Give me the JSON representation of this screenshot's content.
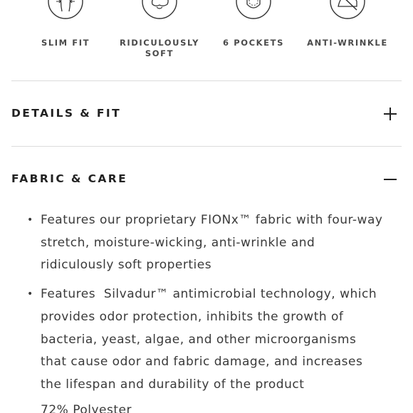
{
  "features": [
    {
      "label": "SLIM FIT",
      "icon": "slim-fit-icon"
    },
    {
      "label": "RIDICULOUSLY\nSOFT",
      "icon": "cotton-soft-icon"
    },
    {
      "label": "6 POCKETS",
      "icon": "pocket-icon"
    },
    {
      "label": "ANTI-WRINKLE",
      "icon": "no-iron-icon"
    }
  ],
  "accordion": {
    "details": {
      "title": "DETAILS & FIT",
      "state": "collapsed"
    },
    "fabric": {
      "title": "FABRIC & CARE",
      "state": "expanded",
      "bullets": [
        "Features our proprietary FIONx™ fabric with four-way stretch, moisture-wicking, anti-wrinkle and ridiculously soft properties",
        "Features  Silvadur™ antimicrobial technology, which provides odor protection, inhibits the growth of bacteria, yeast, algae, and other microorganisms that cause odor and fabric damage, and increases the lifespan and durability of the product",
        "72% Polyester"
      ]
    }
  },
  "colors": {
    "text": "#2d2d2d",
    "divider": "#dcdcdc",
    "icon_stroke": "#333333"
  }
}
